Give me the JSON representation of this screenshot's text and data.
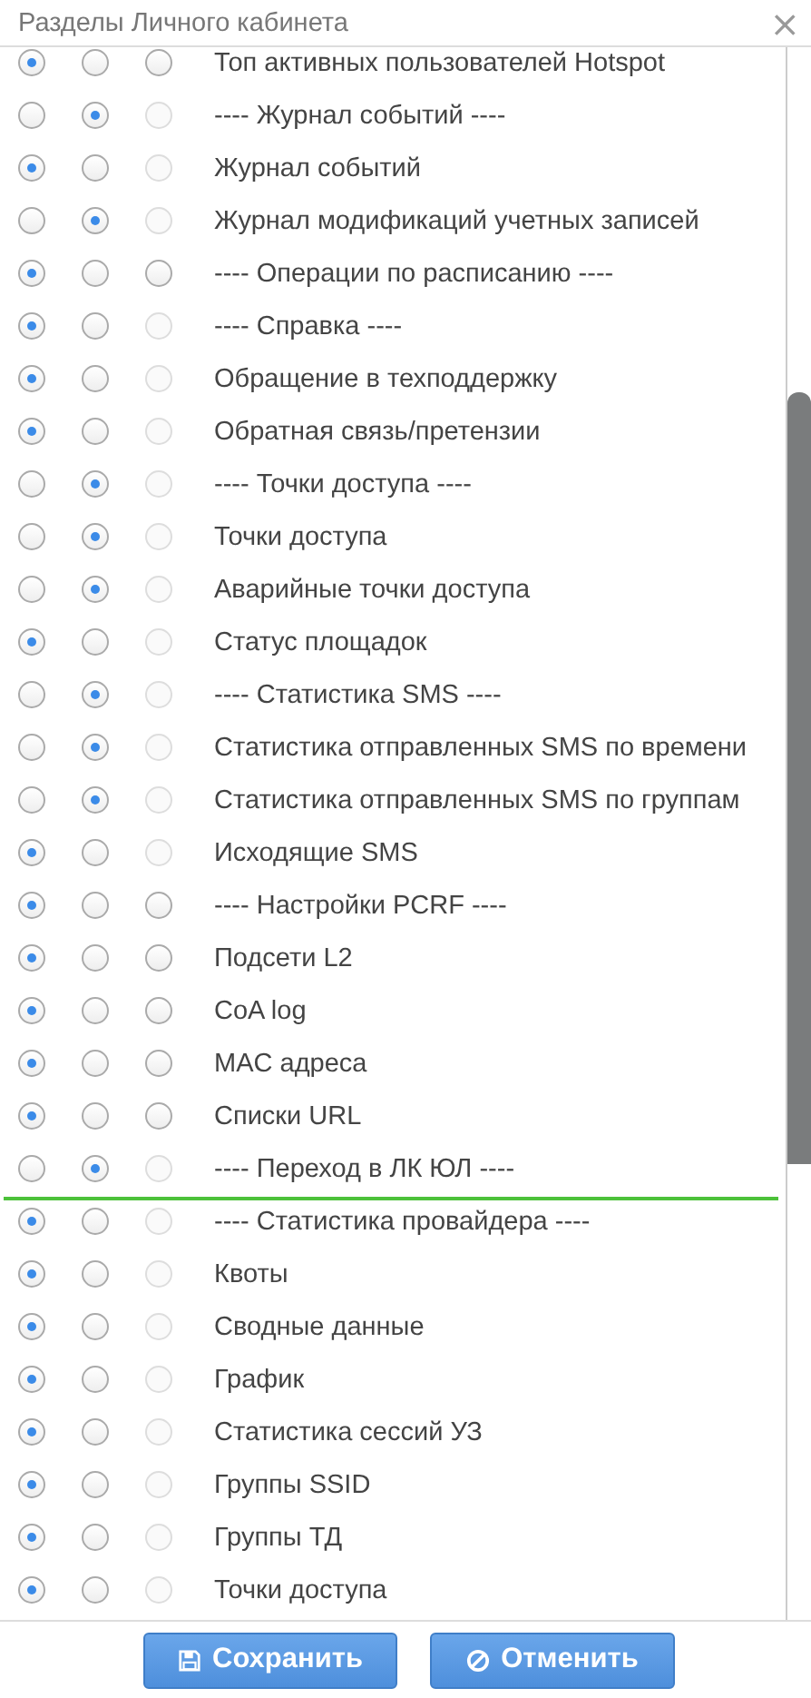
{
  "dialog": {
    "title": "Разделы Личного кабинета",
    "close": "×"
  },
  "rows": [
    {
      "label": "Топ активных пользователей Hotspot",
      "drop_line_below": false,
      "options": [
        {
          "selected": true,
          "disabled": false
        },
        {
          "selected": false,
          "disabled": false
        },
        {
          "selected": false,
          "disabled": false
        }
      ]
    },
    {
      "label": "---- Журнал событий ----",
      "drop_line_below": false,
      "options": [
        {
          "selected": false,
          "disabled": false
        },
        {
          "selected": true,
          "disabled": false
        },
        {
          "selected": false,
          "disabled": true
        }
      ]
    },
    {
      "label": "Журнал событий",
      "drop_line_below": false,
      "options": [
        {
          "selected": true,
          "disabled": false
        },
        {
          "selected": false,
          "disabled": false
        },
        {
          "selected": false,
          "disabled": true
        }
      ]
    },
    {
      "label": "Журнал модификаций учетных записей",
      "drop_line_below": false,
      "options": [
        {
          "selected": false,
          "disabled": false
        },
        {
          "selected": true,
          "disabled": false
        },
        {
          "selected": false,
          "disabled": true
        }
      ]
    },
    {
      "label": "---- Операции по расписанию ----",
      "drop_line_below": false,
      "options": [
        {
          "selected": true,
          "disabled": false
        },
        {
          "selected": false,
          "disabled": false
        },
        {
          "selected": false,
          "disabled": false
        }
      ]
    },
    {
      "label": "---- Справка ----",
      "drop_line_below": false,
      "options": [
        {
          "selected": true,
          "disabled": false
        },
        {
          "selected": false,
          "disabled": false
        },
        {
          "selected": false,
          "disabled": true
        }
      ]
    },
    {
      "label": "Обращение в техподдержку",
      "drop_line_below": false,
      "options": [
        {
          "selected": true,
          "disabled": false
        },
        {
          "selected": false,
          "disabled": false
        },
        {
          "selected": false,
          "disabled": true
        }
      ]
    },
    {
      "label": "Обратная связь/претензии",
      "drop_line_below": false,
      "options": [
        {
          "selected": true,
          "disabled": false
        },
        {
          "selected": false,
          "disabled": false
        },
        {
          "selected": false,
          "disabled": true
        }
      ]
    },
    {
      "label": "---- Точки доступа ----",
      "drop_line_below": false,
      "options": [
        {
          "selected": false,
          "disabled": false
        },
        {
          "selected": true,
          "disabled": false
        },
        {
          "selected": false,
          "disabled": true
        }
      ]
    },
    {
      "label": "Точки доступа",
      "drop_line_below": false,
      "options": [
        {
          "selected": false,
          "disabled": false
        },
        {
          "selected": true,
          "disabled": false
        },
        {
          "selected": false,
          "disabled": true
        }
      ]
    },
    {
      "label": "Аварийные точки доступа",
      "drop_line_below": false,
      "options": [
        {
          "selected": false,
          "disabled": false
        },
        {
          "selected": true,
          "disabled": false
        },
        {
          "selected": false,
          "disabled": true
        }
      ]
    },
    {
      "label": "Статус площадок",
      "drop_line_below": false,
      "options": [
        {
          "selected": true,
          "disabled": false
        },
        {
          "selected": false,
          "disabled": false
        },
        {
          "selected": false,
          "disabled": true
        }
      ]
    },
    {
      "label": "---- Статистика SMS ----",
      "drop_line_below": false,
      "options": [
        {
          "selected": false,
          "disabled": false
        },
        {
          "selected": true,
          "disabled": false
        },
        {
          "selected": false,
          "disabled": true
        }
      ]
    },
    {
      "label": "Статистика отправленных SMS по времени",
      "drop_line_below": false,
      "options": [
        {
          "selected": false,
          "disabled": false
        },
        {
          "selected": true,
          "disabled": false
        },
        {
          "selected": false,
          "disabled": true
        }
      ]
    },
    {
      "label": "Статистика отправленных SMS по группам",
      "drop_line_below": false,
      "options": [
        {
          "selected": false,
          "disabled": false
        },
        {
          "selected": true,
          "disabled": false
        },
        {
          "selected": false,
          "disabled": true
        }
      ]
    },
    {
      "label": "Исходящие SMS",
      "drop_line_below": false,
      "options": [
        {
          "selected": true,
          "disabled": false
        },
        {
          "selected": false,
          "disabled": false
        },
        {
          "selected": false,
          "disabled": true
        }
      ]
    },
    {
      "label": "---- Настройки PCRF ----",
      "drop_line_below": false,
      "options": [
        {
          "selected": true,
          "disabled": false
        },
        {
          "selected": false,
          "disabled": false
        },
        {
          "selected": false,
          "disabled": false
        }
      ]
    },
    {
      "label": "Подсети L2",
      "drop_line_below": false,
      "options": [
        {
          "selected": true,
          "disabled": false
        },
        {
          "selected": false,
          "disabled": false
        },
        {
          "selected": false,
          "disabled": false
        }
      ]
    },
    {
      "label": "CoA log",
      "drop_line_below": false,
      "options": [
        {
          "selected": true,
          "disabled": false
        },
        {
          "selected": false,
          "disabled": false
        },
        {
          "selected": false,
          "disabled": false
        }
      ]
    },
    {
      "label": "MAC адреса",
      "drop_line_below": false,
      "options": [
        {
          "selected": true,
          "disabled": false
        },
        {
          "selected": false,
          "disabled": false
        },
        {
          "selected": false,
          "disabled": false
        }
      ]
    },
    {
      "label": "Списки URL",
      "drop_line_below": false,
      "options": [
        {
          "selected": true,
          "disabled": false
        },
        {
          "selected": false,
          "disabled": false
        },
        {
          "selected": false,
          "disabled": false
        }
      ]
    },
    {
      "label": "---- Переход в ЛК ЮЛ ----",
      "drop_line_below": true,
      "options": [
        {
          "selected": false,
          "disabled": false
        },
        {
          "selected": true,
          "disabled": false
        },
        {
          "selected": false,
          "disabled": true
        }
      ]
    },
    {
      "label": "---- Статистика провайдера ----",
      "drop_line_below": false,
      "options": [
        {
          "selected": true,
          "disabled": false
        },
        {
          "selected": false,
          "disabled": false
        },
        {
          "selected": false,
          "disabled": true
        }
      ]
    },
    {
      "label": "Квоты",
      "drop_line_below": false,
      "options": [
        {
          "selected": true,
          "disabled": false
        },
        {
          "selected": false,
          "disabled": false
        },
        {
          "selected": false,
          "disabled": true
        }
      ]
    },
    {
      "label": "Сводные данные",
      "drop_line_below": false,
      "options": [
        {
          "selected": true,
          "disabled": false
        },
        {
          "selected": false,
          "disabled": false
        },
        {
          "selected": false,
          "disabled": true
        }
      ]
    },
    {
      "label": "График",
      "drop_line_below": false,
      "options": [
        {
          "selected": true,
          "disabled": false
        },
        {
          "selected": false,
          "disabled": false
        },
        {
          "selected": false,
          "disabled": true
        }
      ]
    },
    {
      "label": "Статистика сессий УЗ",
      "drop_line_below": false,
      "options": [
        {
          "selected": true,
          "disabled": false
        },
        {
          "selected": false,
          "disabled": false
        },
        {
          "selected": false,
          "disabled": true
        }
      ]
    },
    {
      "label": "Группы SSID",
      "drop_line_below": false,
      "options": [
        {
          "selected": true,
          "disabled": false
        },
        {
          "selected": false,
          "disabled": false
        },
        {
          "selected": false,
          "disabled": true
        }
      ]
    },
    {
      "label": "Группы ТД",
      "drop_line_below": false,
      "options": [
        {
          "selected": true,
          "disabled": false
        },
        {
          "selected": false,
          "disabled": false
        },
        {
          "selected": false,
          "disabled": true
        }
      ]
    },
    {
      "label": "Точки доступа",
      "drop_line_below": false,
      "options": [
        {
          "selected": true,
          "disabled": false
        },
        {
          "selected": false,
          "disabled": false
        },
        {
          "selected": false,
          "disabled": true
        }
      ]
    }
  ],
  "buttons": [
    {
      "kind": "save",
      "label": "Сохранить"
    },
    {
      "kind": "cancel",
      "label": "Отменить"
    }
  ]
}
